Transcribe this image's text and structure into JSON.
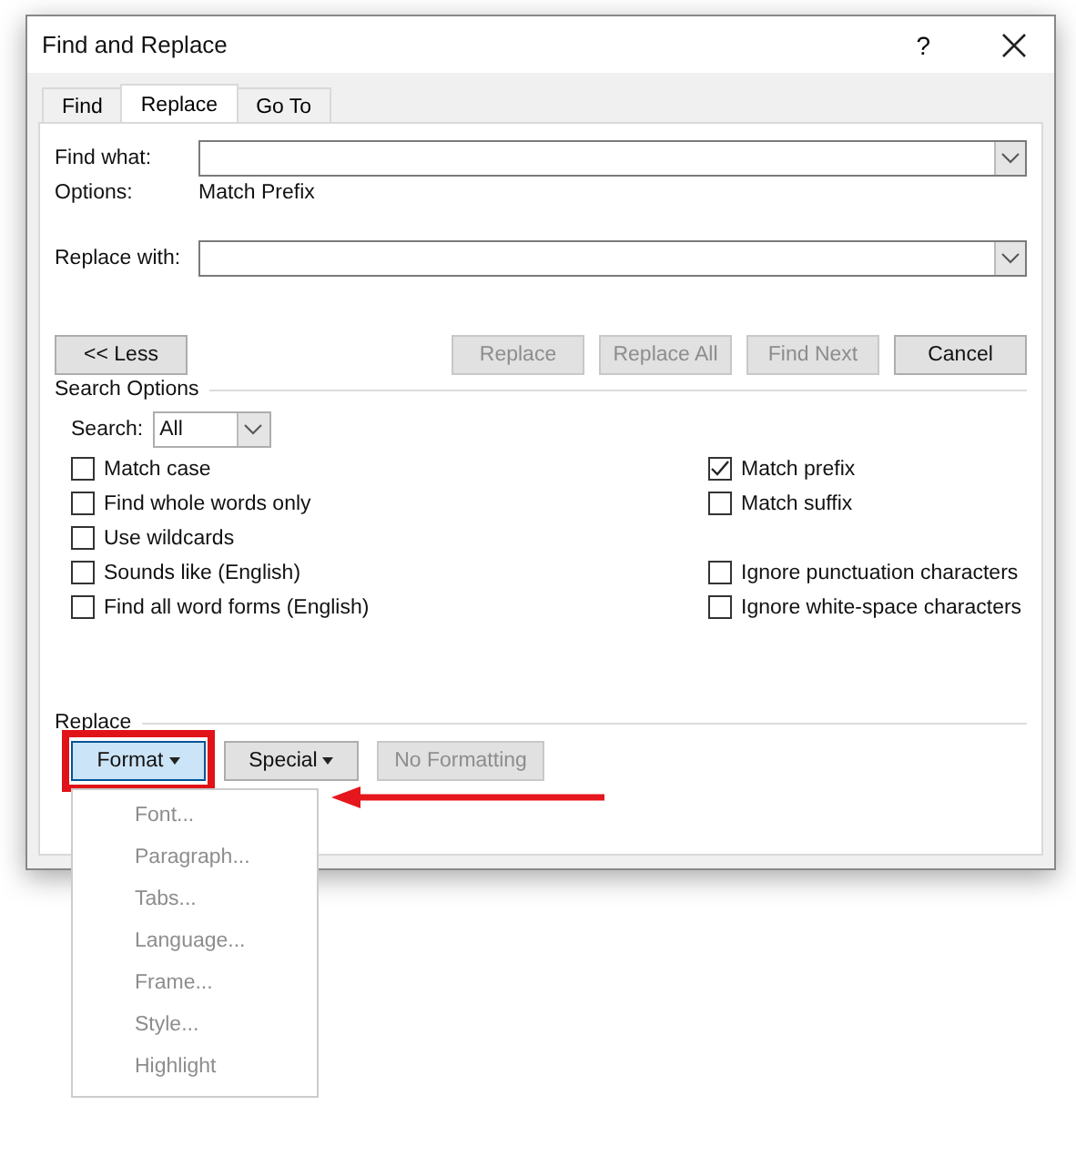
{
  "window": {
    "title": "Find and Replace",
    "help": "?"
  },
  "tabs": [
    {
      "label": "Find",
      "selected": false
    },
    {
      "label": "Replace",
      "selected": true
    },
    {
      "label": "Go To",
      "selected": false
    }
  ],
  "find_what": {
    "label": "Find what:"
  },
  "options": {
    "label": "Options:",
    "value": "Match Prefix"
  },
  "replace_with": {
    "label": "Replace with:"
  },
  "buttons": [
    {
      "label": "<< Less",
      "disabled": false
    },
    {
      "label": "Replace",
      "disabled": true
    },
    {
      "label": "Replace All",
      "disabled": true
    },
    {
      "label": "Find Next",
      "disabled": true
    },
    {
      "label": "Cancel",
      "disabled": false
    }
  ],
  "search_options": {
    "title": "Search Options",
    "search_label": "Search:",
    "search_value": "All",
    "rows": [
      {
        "left": {
          "label": "Match case",
          "checked": false
        },
        "right": {
          "label": "Match prefix",
          "checked": true
        }
      },
      {
        "left": {
          "label": "Find whole words only",
          "checked": false
        },
        "right": {
          "label": "Match suffix",
          "checked": false
        }
      },
      {
        "left": {
          "label": "Use wildcards",
          "checked": false
        }
      },
      {
        "left": {
          "label": "Sounds like (English)",
          "checked": false
        },
        "right": {
          "label": "Ignore punctuation characters",
          "checked": false
        }
      },
      {
        "left": {
          "label": "Find all word forms (English)",
          "checked": false
        },
        "right": {
          "label": "Ignore white-space characters",
          "checked": false
        }
      }
    ]
  },
  "replace": {
    "title": "Replace",
    "buttons": [
      {
        "label": "Format",
        "caret": true,
        "selected": true,
        "disabled": false
      },
      {
        "label": "Special",
        "caret": true,
        "selected": false,
        "disabled": false
      },
      {
        "label": "No Formatting",
        "caret": false,
        "selected": false,
        "disabled": true
      }
    ]
  },
  "format_menu": [
    {
      "label": "Font...",
      "disabled": true
    },
    {
      "label": "Paragraph...",
      "disabled": true
    },
    {
      "label": "Tabs...",
      "disabled": true
    },
    {
      "label": "Language...",
      "disabled": true
    },
    {
      "label": "Frame...",
      "disabled": true
    },
    {
      "label": "Style...",
      "disabled": true
    },
    {
      "label": "Highlight",
      "disabled": true
    }
  ]
}
